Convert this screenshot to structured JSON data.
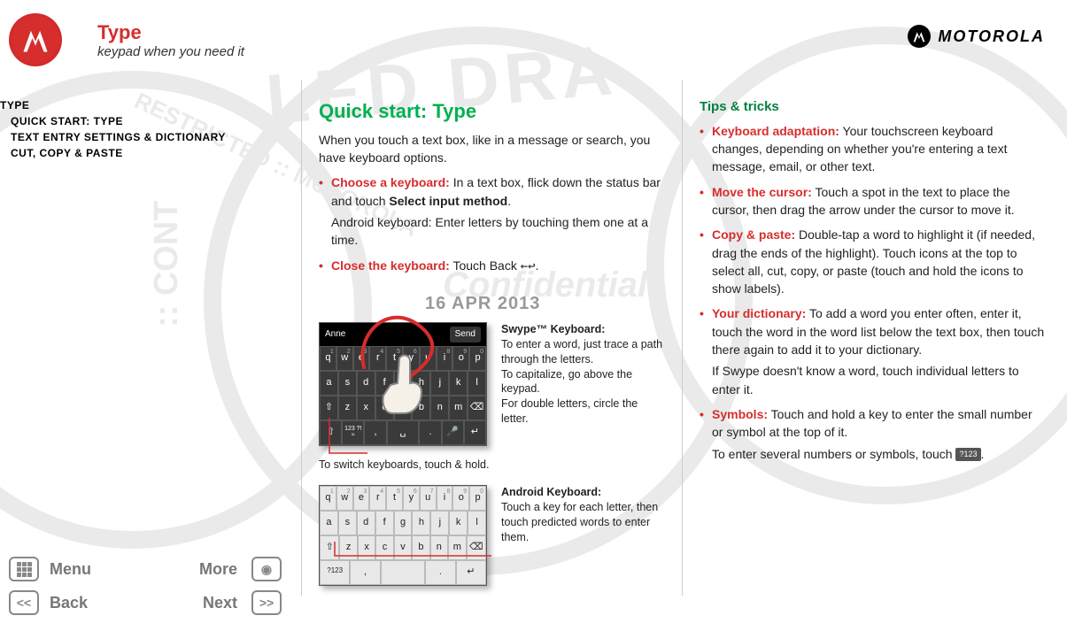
{
  "header": {
    "title": "Type",
    "subtitle": "keypad when you need it",
    "brand": "MOTOROLA"
  },
  "sidebar": {
    "items": [
      {
        "label": "TYPE",
        "indent": false
      },
      {
        "label": "QUICK START: TYPE",
        "indent": true
      },
      {
        "label": "TEXT ENTRY SETTINGS & DICTIONARY",
        "indent": true
      },
      {
        "label": "CUT, COPY & PASTE",
        "indent": true
      }
    ]
  },
  "col1": {
    "heading": "Quick start: Type",
    "intro": "When you touch a text box, like in a message or search, you have keyboard options.",
    "bullets": [
      {
        "term": "Choose a keyboard:",
        "rest_a": " In a text box, flick down the status bar and touch ",
        "bold": "Select input method",
        "rest_b": ".",
        "sub": "Android keyboard: Enter letters by touching them one at a time."
      },
      {
        "term": "Close the keyboard:",
        "rest_a": " Touch Back ",
        "icon": "←↩",
        "rest_b": "."
      }
    ],
    "date": "16 APR 2013",
    "swype": {
      "compose_text": "Anne",
      "send": "Send",
      "title": "Swype™ Keyboard:",
      "line1": "To enter a word, just trace a path through the letters.",
      "line2": "To capitalize, go above the keypad.",
      "line3": "For double letters, circle the letter."
    },
    "switch_note": "To switch keyboards, touch & hold.",
    "android_kb": {
      "title": "Android Keyboard:",
      "desc": "Touch a key for each letter, then touch predicted words to enter them."
    },
    "keys_row1": [
      "q",
      "w",
      "e",
      "r",
      "t",
      "y",
      "u",
      "i",
      "o",
      "p"
    ],
    "keys_row1_sup": [
      "1",
      "2",
      "3",
      "4",
      "5",
      "6",
      "7",
      "8",
      "9",
      "0"
    ],
    "keys_row2": [
      "a",
      "s",
      "d",
      "f",
      "g",
      "h",
      "j",
      "k",
      "l"
    ],
    "keys_row3": [
      "z",
      "x",
      "c",
      "v",
      "b",
      "n",
      "m"
    ],
    "bottom_row": {
      "shift": "⇧",
      "sym": "123\n?!≈",
      "comma": ",",
      "space": "␣",
      "period": ".",
      "mic": "🎤",
      "enter": "↵",
      "del": "⌫"
    }
  },
  "col2": {
    "heading": "Tips & tricks",
    "bullets": [
      {
        "term": "Keyboard adaptation:",
        "rest": " Your touchscreen keyboard changes, depending on whether you're entering a text message, email, or other text."
      },
      {
        "term": "Move the cursor:",
        "rest": " Touch a spot in the text to place the cursor, then drag the arrow under the cursor to move it."
      },
      {
        "term": "Copy & paste:",
        "rest": " Double-tap a word to highlight it (if needed, drag the ends of the highlight). Touch icons at the top to select all, cut, copy, or paste (touch and hold the icons to show labels)."
      },
      {
        "term": "Your dictionary:",
        "rest": " To add a word you enter often, enter it, touch the word in the word list below the text box, then touch there again to add it to your dictionary.",
        "sub": "If Swype doesn't know a word, touch individual letters to enter it."
      },
      {
        "term": "Symbols:",
        "rest": " Touch and hold a key to enter the small number or symbol at the top of it.",
        "sub_a": "To enter several numbers or symbols, touch ",
        "badge": "?123",
        "sub_b": "."
      }
    ]
  },
  "footer": {
    "menu": "Menu",
    "more": "More",
    "back": "Back",
    "next": "Next"
  }
}
